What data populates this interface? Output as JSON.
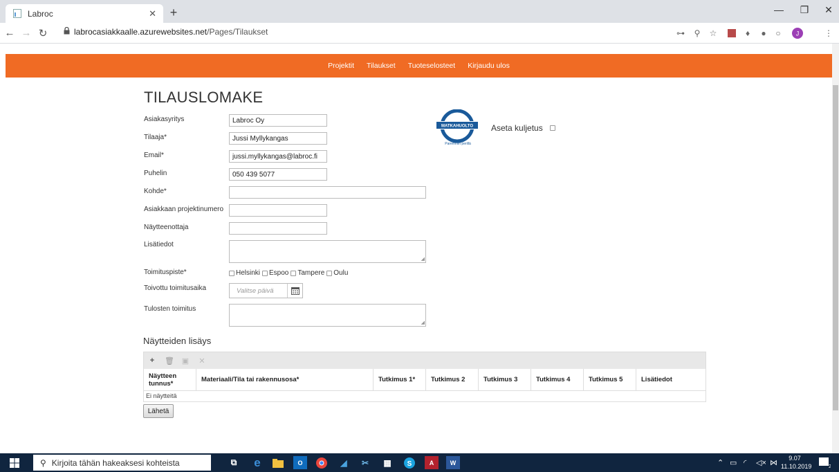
{
  "browser": {
    "tab_title": "Labroc",
    "url_host": "labrocasiakkaalle.azurewebsites.net",
    "url_path": "/Pages/Tilaukset"
  },
  "nav": {
    "items": [
      "Projektit",
      "Tilaukset",
      "Tuoteselosteet",
      "Kirjaudu ulos"
    ]
  },
  "form": {
    "title": "TILAUSLOMAKE",
    "company_label": "Asiakasyritys",
    "company_value": "Labroc Oy",
    "orderer_label": "Tilaaja*",
    "orderer_value": "Jussi Myllykangas",
    "email_label": "Email*",
    "email_value": "jussi.myllykangas@labroc.fi",
    "phone_label": "Puhelin",
    "phone_value": "050 439 5077",
    "target_label": "Kohde*",
    "target_value": "",
    "project_no_label": "Asiakkaan projektinumero",
    "project_no_value": "",
    "sampler_label": "Näytteenottaja",
    "sampler_value": "",
    "notes_label": "Lisätiedot",
    "delivery_point_label": "Toimituspiste*",
    "cities": [
      "Helsinki",
      "Espoo",
      "Tampere",
      "Oulu"
    ],
    "delivery_time_label": "Toivottu toimitusaika",
    "date_placeholder": "Valitse päivä",
    "results_label": "Tulosten toimitus"
  },
  "transport": {
    "logo_text": "MATKAHUOLTO",
    "logo_tagline": "Paremmin perillä",
    "label": "Aseta kuljetus"
  },
  "samples": {
    "title": "Näytteiden lisäys",
    "columns": [
      "Näytteen tunnus*",
      "Materiaali/Tila tai rakennusosa*",
      "Tutkimus 1*",
      "Tutkimus 2",
      "Tutkimus 3",
      "Tutkimus 4",
      "Tutkimus 5",
      "Lisätiedot"
    ],
    "empty_text": "Ei näytteitä",
    "send_label": "Lähetä"
  },
  "taskbar": {
    "search_placeholder": "Kirjoita tähän hakeaksesi kohteista",
    "time": "9.07",
    "date": "11.10.2019",
    "notification_count": "22"
  }
}
